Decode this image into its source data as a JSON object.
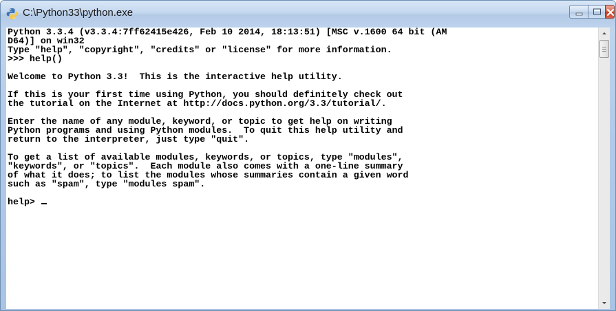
{
  "window": {
    "title": "C:\\Python33\\python.exe"
  },
  "console": {
    "lines": [
      "Python 3.3.4 (v3.3.4:7ff62415e426, Feb 10 2014, 18:13:51) [MSC v.1600 64 bit (AM",
      "D64)] on win32",
      "Type \"help\", \"copyright\", \"credits\" or \"license\" for more information.",
      ">>> help()",
      "",
      "Welcome to Python 3.3!  This is the interactive help utility.",
      "",
      "If this is your first time using Python, you should definitely check out",
      "the tutorial on the Internet at http://docs.python.org/3.3/tutorial/.",
      "",
      "Enter the name of any module, keyword, or topic to get help on writing",
      "Python programs and using Python modules.  To quit this help utility and",
      "return to the interpreter, just type \"quit\".",
      "",
      "To get a list of available modules, keywords, or topics, type \"modules\",",
      "\"keywords\", or \"topics\".  Each module also comes with a one-line summary",
      "of what it does; to list the modules whose summaries contain a given word",
      "such as \"spam\", type \"modules spam\".",
      ""
    ],
    "prompt": "help> "
  },
  "colors": {
    "console_background": "#ffffff",
    "console_text": "#000000",
    "title_text": "#1a1a1a"
  },
  "icons": {
    "app": "python-icon",
    "minimize": "minimize-icon",
    "maximize": "maximize-icon",
    "close": "close-icon",
    "scroll_up": "chevron-up-icon",
    "scroll_down": "chevron-down-icon"
  }
}
